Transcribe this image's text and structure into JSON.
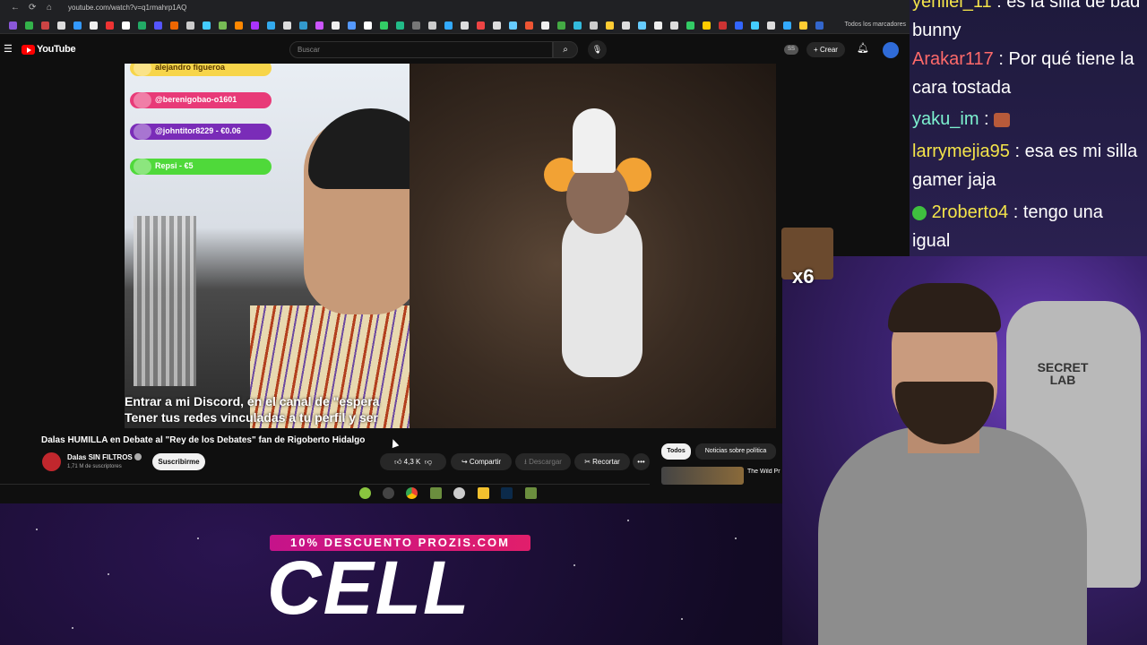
{
  "browser": {
    "url": "youtube.com/watch?v=q1rmahrp1AQ",
    "bookmarks_all": "Todos los marcadores"
  },
  "youtube": {
    "logo_text": "YouTube",
    "search_placeholder": "Buscar",
    "create_label": "Crear",
    "badge": "SS"
  },
  "video": {
    "donations": [
      "alejandro figueroa",
      "@berenigobao-o1601",
      "@johntitor8229 - €0.06",
      "Repsi - €5"
    ],
    "subtitle_line1": "Entrar a mi Discord, en el canal de \"espera",
    "subtitle_line2": "Tener tus redes vinculadas a tu perfil y ser",
    "title": "Dalas HUMILLA en Debate al \"Rey de los Debates\" fan de Rigoberto Hidalgo"
  },
  "channel": {
    "name": "Dalas SIN FILTROS",
    "subscribers": "1,71 M de suscriptores",
    "subscribe_label": "Suscribirme"
  },
  "actions": {
    "likes": "4,3 K",
    "share": "Compartir",
    "download": "Descargar",
    "clip": "Recortar",
    "more": "•••"
  },
  "chips": {
    "all": "Todos",
    "news": "Noticias sobre política"
  },
  "recommendation": {
    "title": "The Wild Pr"
  },
  "promo": {
    "banner": "10% DESCUENTO PROZIS.COM",
    "word": "CELL"
  },
  "chat": [
    {
      "user": "yeniiei_11",
      "message": ": es la silla de bad bunny",
      "color": "#f4e44a"
    },
    {
      "user": "Arakar117",
      "message": ": Por qué tiene la cara tostada",
      "color": "#ff6a6a"
    },
    {
      "user": "yaku_im",
      "message": ":",
      "color": "#7df2d0"
    },
    {
      "user": "larrymejia95",
      "message": ": esa es mi silla gamer jaja",
      "color": "#f4e44a"
    },
    {
      "user": "2roberto4",
      "message": ": tengo una igual",
      "color": "#f4e44a"
    }
  ],
  "overlay": {
    "emote_count": "x6"
  },
  "chair_logo": "SECRET\nLAB"
}
